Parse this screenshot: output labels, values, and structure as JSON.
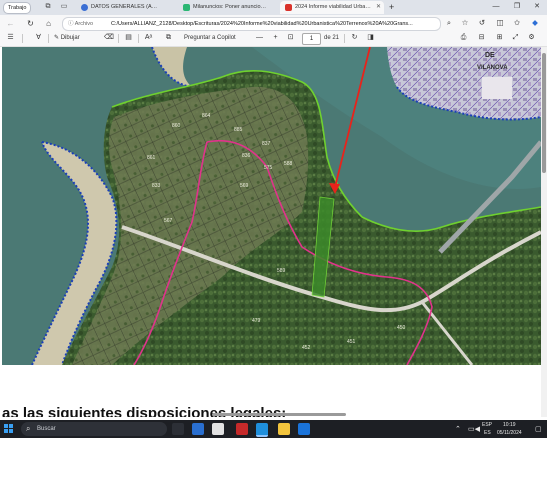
{
  "browser": {
    "workspace_label": "Trabajo",
    "tabs": [
      {
        "title": "DATOS GENERALES (AZR)",
        "active": false,
        "favicon_color": "#3b6fd4"
      },
      {
        "title": "Milanuncios: Poner anuncios gratis",
        "active": false,
        "favicon_color": "#2bb673"
      },
      {
        "title": "2024 Informe viabilidad Urbanisti",
        "active": true,
        "favicon_color": "#d9322b"
      }
    ],
    "new_tab": "+",
    "window_controls": [
      "—",
      "❐",
      "✕"
    ],
    "address": {
      "info_label": "Archivo",
      "url": "C:/Users/ALLIANZ_2128/Desktop/Escrituras/2024%20Informe%20viabilidad%20Urbanistica%20Terrenos%20A%20Grans..."
    }
  },
  "pdf_toolbar": {
    "draw_label": "Dibujar",
    "ask_copilot_label": "Preguntar a Copilot",
    "zoom_minus": "—",
    "zoom_plus": "+",
    "page_current": "1",
    "page_total": "de 21"
  },
  "document": {
    "map_labels": {
      "town": "DE",
      "town2": "VILANOVA",
      "parcels": [
        "885",
        "864",
        "861",
        "860",
        "837",
        "836",
        "833",
        "567",
        "575",
        "569",
        "588",
        "589",
        "450",
        "479",
        "451",
        "452"
      ]
    },
    "body_text": "as las siguientes disposiciones legales:"
  },
  "taskbar": {
    "search_placeholder": "Buscar",
    "language": "ESP",
    "language_sub": "ES",
    "time": "10:19",
    "date": "05/11/2024"
  },
  "colors": {
    "accent": "#2d6fd6",
    "pdf_favicon": "#d9322b",
    "taskbar": "#1d1f24",
    "boundary_pink": "#e0338b",
    "boundary_green": "#6fd12f",
    "arrow_red": "#e8231b",
    "coast_blue": "#1b3fb8"
  }
}
